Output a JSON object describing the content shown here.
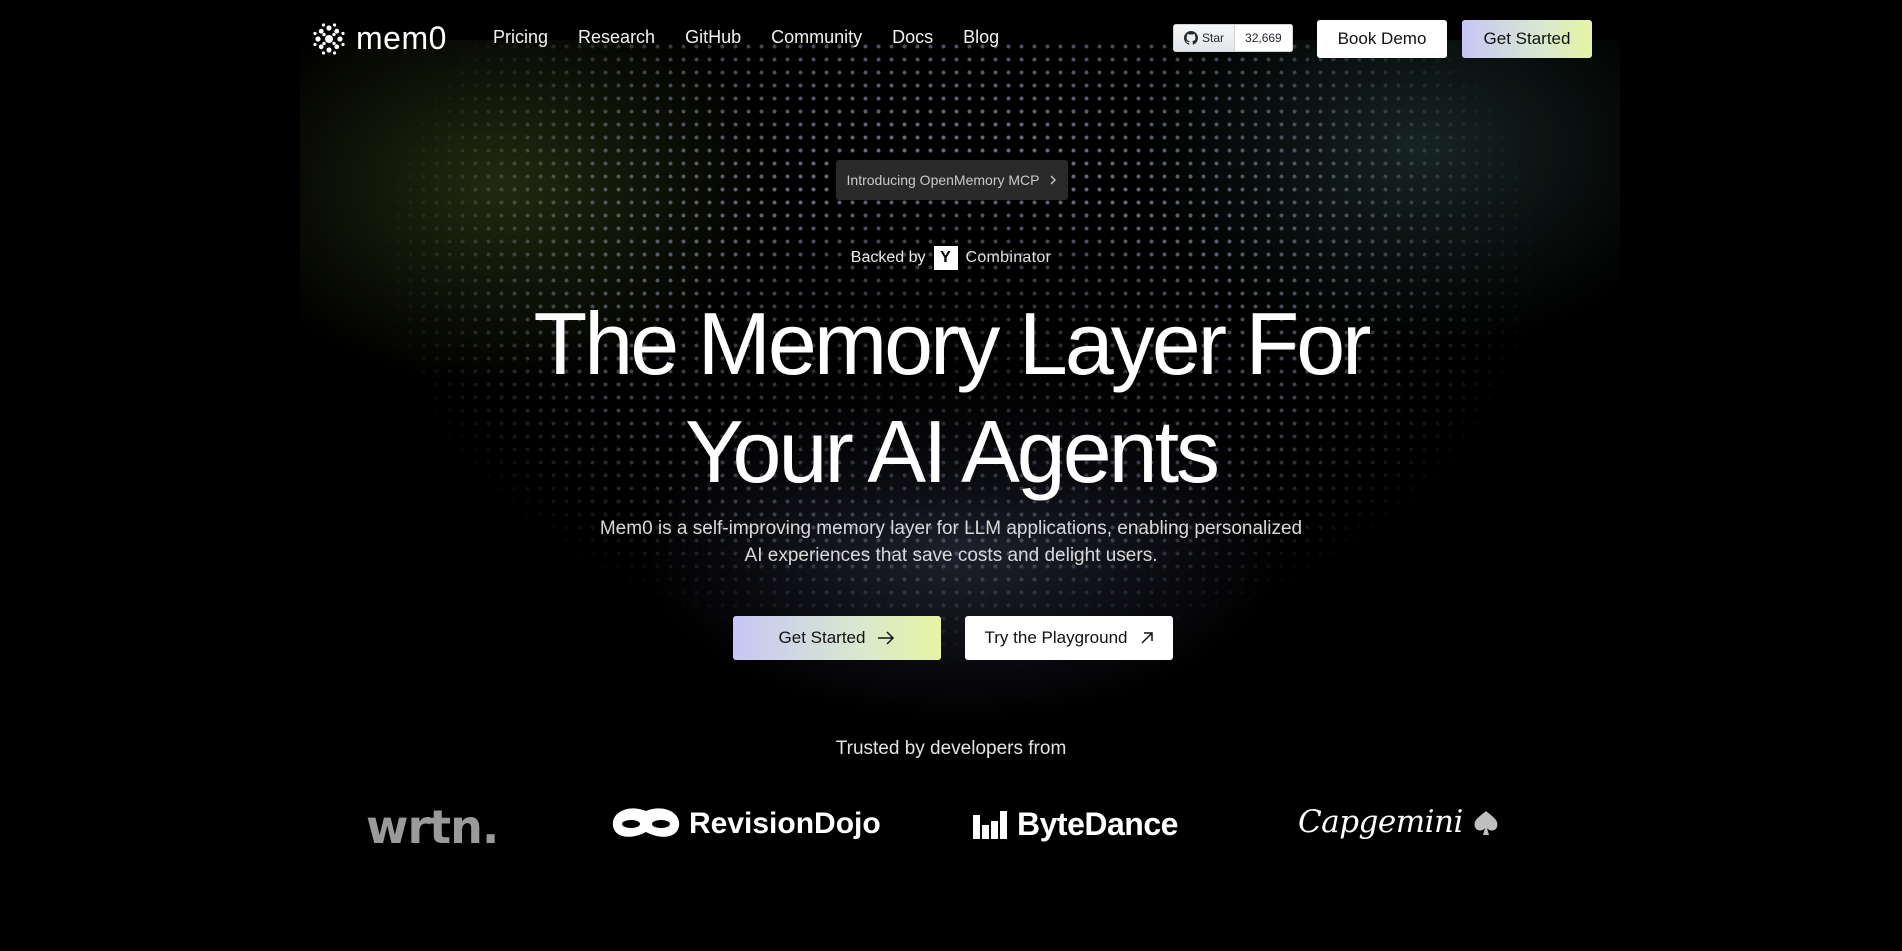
{
  "brand": {
    "name": "mem0"
  },
  "nav": {
    "links": [
      "Pricing",
      "Research",
      "GitHub",
      "Community",
      "Docs",
      "Blog"
    ],
    "github": {
      "star_label": "Star",
      "count": "32,669"
    },
    "book_demo": "Book Demo",
    "get_started": "Get Started"
  },
  "hero": {
    "announcement": "Introducing OpenMemory MCP",
    "backed_prefix": "Backed by",
    "yc_letter": "Y",
    "yc_name": "Combinator",
    "headline_line1": "The Memory Layer For",
    "headline_line2": "Your AI Agents",
    "sub_line1": "Mem0 is a self-improving memory layer for LLM applications, enabling personalized",
    "sub_line2": "AI experiences that save costs and delight users.",
    "cta_primary": "Get Started",
    "cta_secondary": "Try the Playground"
  },
  "trusted": {
    "label": "Trusted by developers from",
    "logos": [
      "wrtn.",
      "RevisionDojo",
      "ByteDance",
      "Capgemini"
    ]
  },
  "colors": {
    "background": "#000000",
    "cta_gradient_start": "#c7c6f5",
    "cta_gradient_end": "#e6f4a3",
    "announcement_bg": "#2a2a2a"
  }
}
